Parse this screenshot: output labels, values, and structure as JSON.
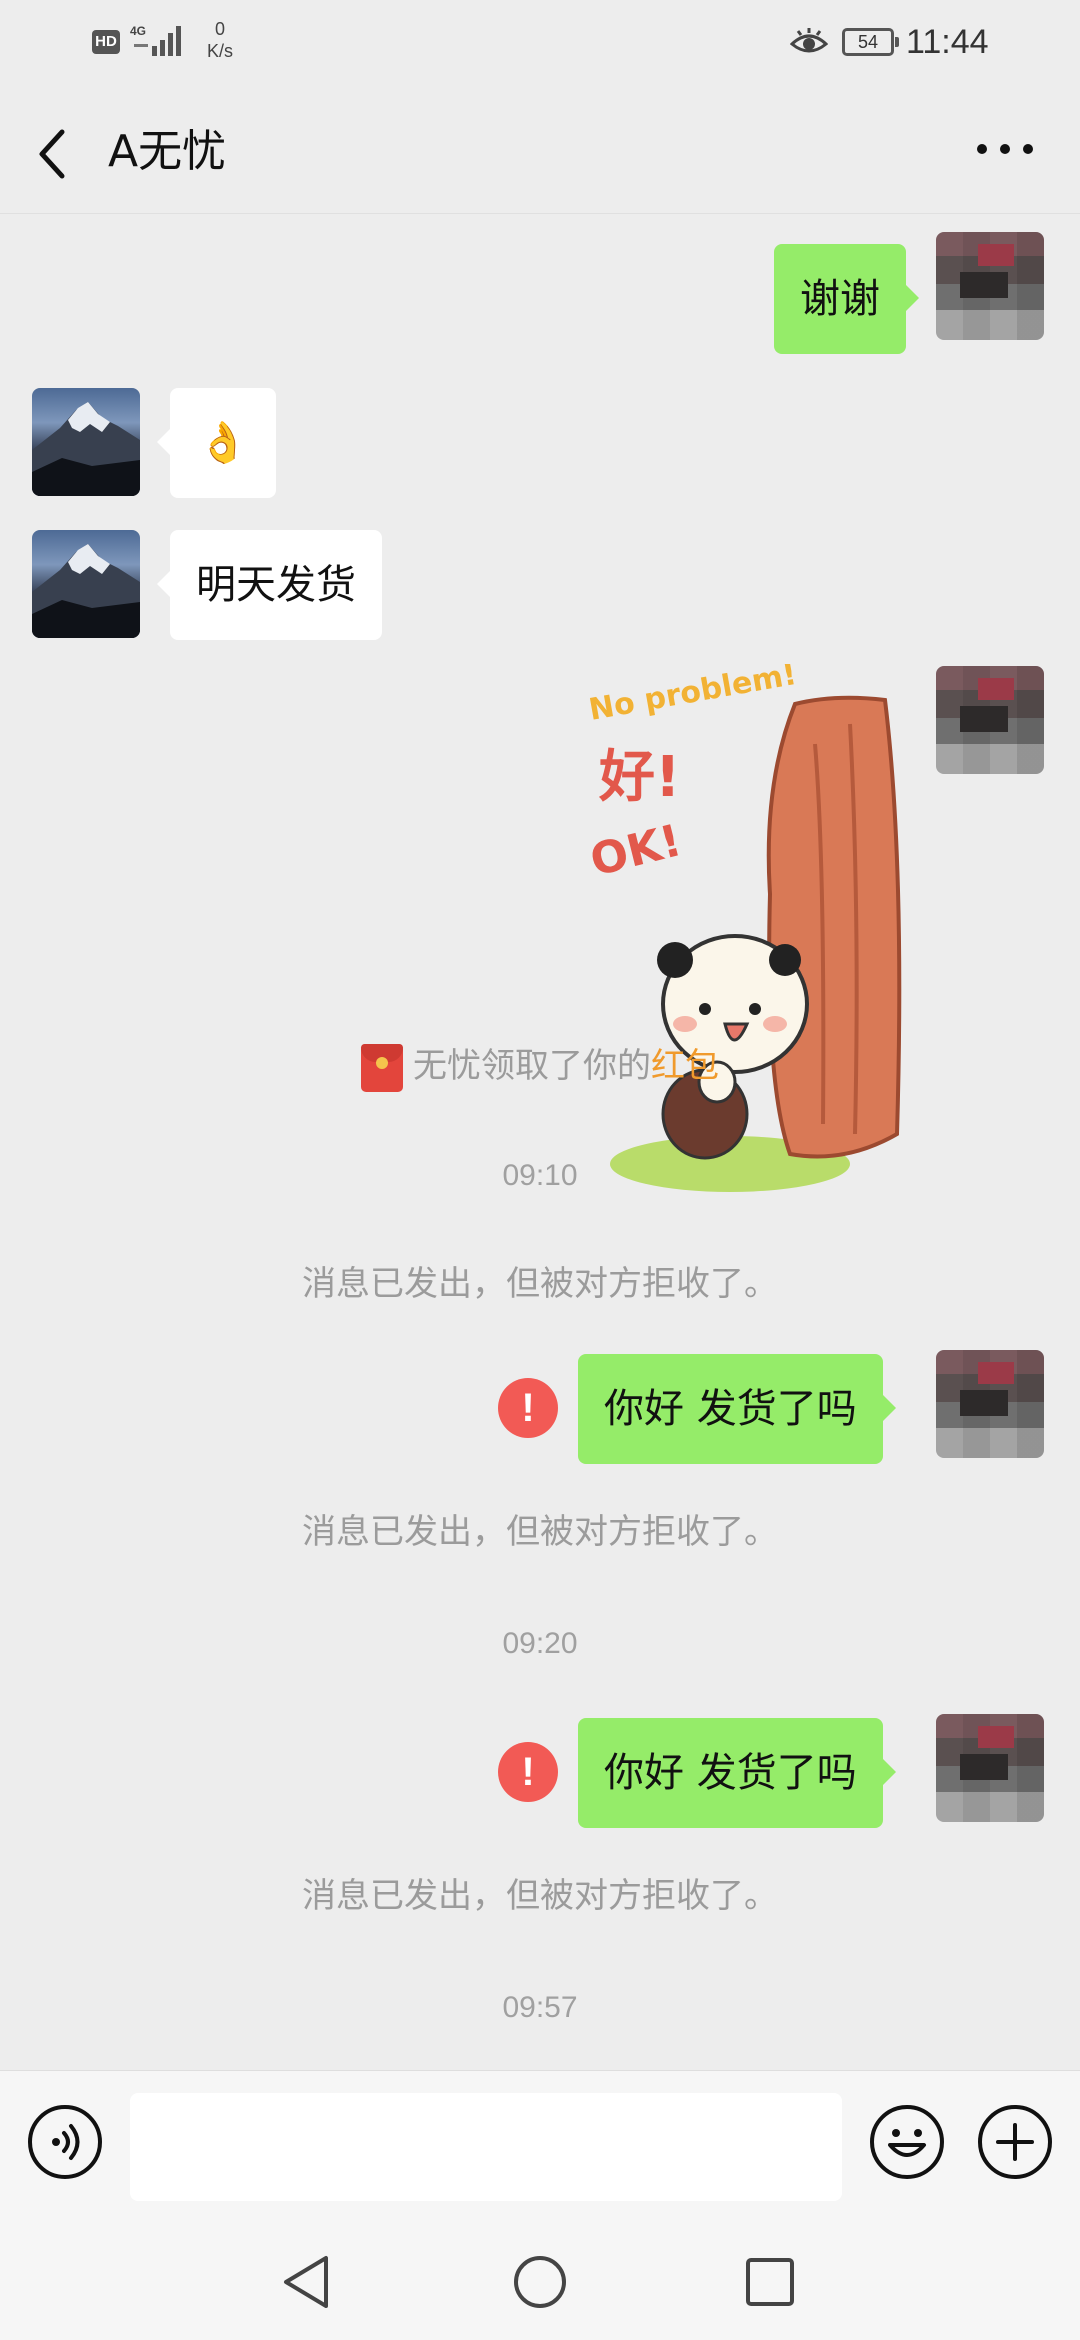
{
  "status_bar": {
    "hd": "HD",
    "network_type": "4G",
    "net_speed_value": "0",
    "net_speed_unit": "K/s",
    "battery": "54",
    "time": "11:44",
    "icons": [
      "hd-icon",
      "signal-icon",
      "eye-comfort-icon",
      "battery-icon"
    ]
  },
  "header": {
    "title": "A无忧",
    "icons": [
      "back-chevron-icon",
      "more-dots-icon"
    ]
  },
  "messages": [
    {
      "type": "text",
      "direction": "out",
      "text": "谢谢"
    },
    {
      "type": "emoji",
      "direction": "in",
      "text": "👌"
    },
    {
      "type": "text",
      "direction": "in",
      "text": "明天发货"
    },
    {
      "type": "sticker",
      "direction": "out",
      "sticker_text": [
        "No problem!",
        "好!",
        "OK!"
      ]
    },
    {
      "type": "system",
      "text_prefix": "无忧领取了你的",
      "link_text": "红包"
    },
    {
      "type": "timestamp",
      "text": "09:10"
    },
    {
      "type": "system",
      "text": "消息已发出，但被对方拒收了。"
    },
    {
      "type": "text",
      "direction": "out",
      "status": "failed",
      "text": "你好 发货了吗"
    },
    {
      "type": "system",
      "text": "消息已发出，但被对方拒收了。"
    },
    {
      "type": "timestamp",
      "text": "09:20"
    },
    {
      "type": "text",
      "direction": "out",
      "status": "failed",
      "text": "你好 发货了吗"
    },
    {
      "type": "system",
      "text": "消息已发出，但被对方拒收了。"
    },
    {
      "type": "timestamp",
      "text": "09:57"
    }
  ],
  "input_bar": {
    "message_value": "",
    "icons": [
      "voice-icon",
      "emoji-icon",
      "plus-icon"
    ]
  },
  "nav_bar": {
    "icons": [
      "nav-back-icon",
      "nav-home-icon",
      "nav-recents-icon"
    ]
  },
  "colors": {
    "background": "#ededed",
    "outgoing_bubble": "#95ec69",
    "incoming_bubble": "#ffffff",
    "system_text": "#9b9b9b",
    "red_packet_link": "#f09a2c",
    "failed_icon": "#f25a55"
  }
}
